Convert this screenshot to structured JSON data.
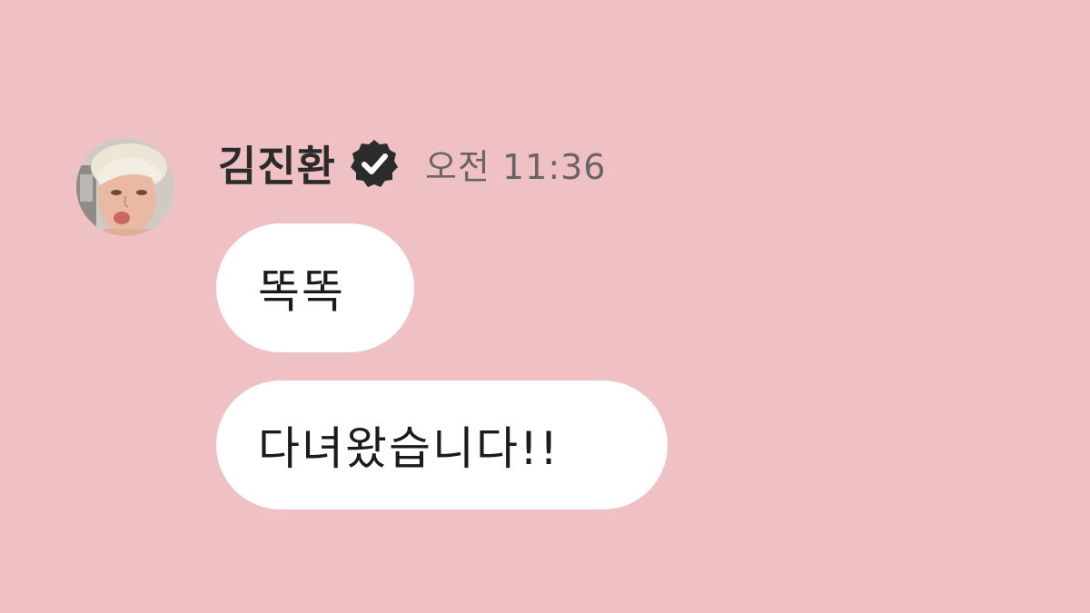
{
  "message_group": {
    "sender": {
      "name": "김진환",
      "verified": true,
      "avatar": "profile-photo"
    },
    "timestamp": "오전 11:36",
    "messages": [
      {
        "text": "똑똑"
      },
      {
        "text": "다녀왔습니다!!"
      }
    ]
  },
  "colors": {
    "background": "#efc1c5",
    "bubble": "#ffffff",
    "name_text": "#2b2b2b",
    "time_text": "#6a6465",
    "verified_badge": "#2b2b2b"
  },
  "icons": {
    "verified": "verified-check-badge-icon"
  }
}
